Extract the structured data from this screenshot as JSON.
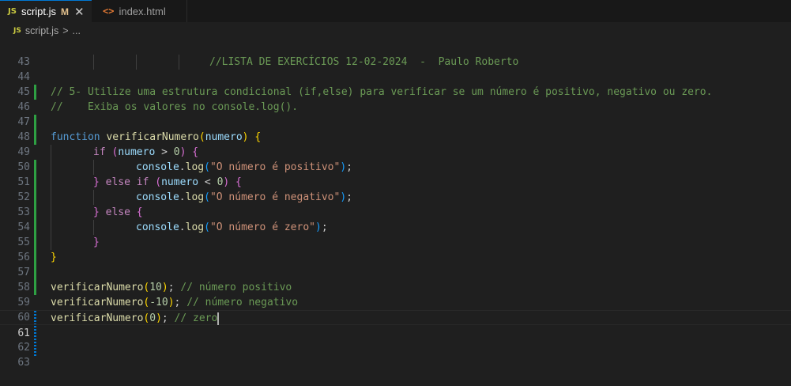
{
  "tabs": [
    {
      "icon": "JS",
      "label": "script.js",
      "modified": "M",
      "close": "✕"
    },
    {
      "icon": "<>",
      "label": "index.html"
    }
  ],
  "breadcrumb": {
    "icon": "JS",
    "file": "script.js",
    "separator": ">",
    "rest": "..."
  },
  "editor": {
    "line_numbers": [
      "43",
      "44",
      "45",
      "46",
      "47",
      "48",
      "49",
      "50",
      "51",
      "52",
      "53",
      "54",
      "55",
      "56",
      "57",
      "58",
      "59",
      "60",
      "61",
      "62",
      "63"
    ],
    "code": {
      "l44": "//LISTA DE EXERCÍCIOS 12-02-2024  -  Paulo Roberto",
      "l46": "// 5- Utilize uma estrutura condicional (if,else) para verificar se um número é positivo, negativo ou zero.",
      "l47": "//    Exiba os valores no console.log().",
      "kw_function": "function",
      "fn_name": "verificarNumero",
      "param": "numero",
      "kw_if": "if",
      "kw_else": "else",
      "gt": " > ",
      "lt": " < ",
      "zero": "0",
      "console": "console",
      "log": "log",
      "str_pos": "\"O número é positivo\"",
      "str_neg": "\"O número é negativo\"",
      "str_zero": "\"O número é zero\"",
      "n10": "10",
      "nm10": "-10",
      "n0": "0",
      "cmt59": "// número positivo",
      "cmt60": "// número negativo",
      "cmt61": "// zero"
    }
  }
}
